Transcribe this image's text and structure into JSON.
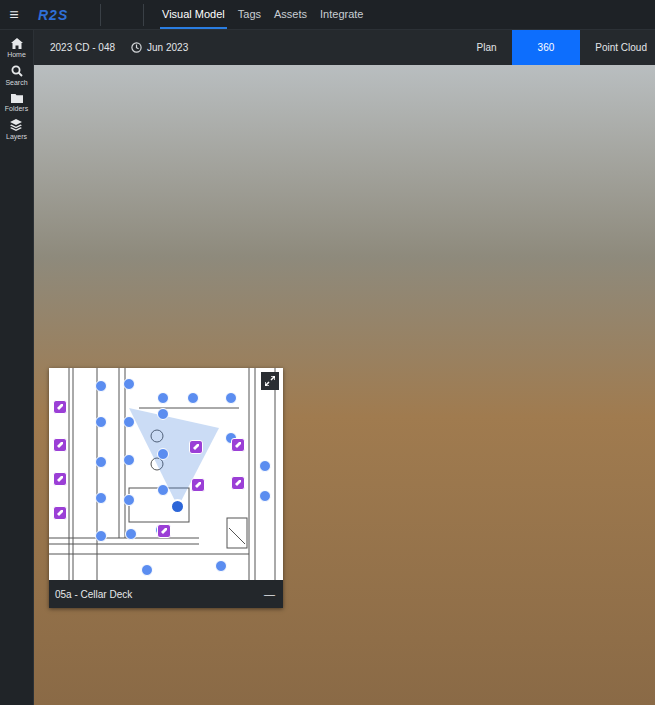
{
  "app": {
    "menu_icon": "≡",
    "logo": "R2S"
  },
  "nav_tabs": [
    {
      "label": "Visual Model",
      "selected": true
    },
    {
      "label": "Tags",
      "selected": false
    },
    {
      "label": "Assets",
      "selected": false
    },
    {
      "label": "Integrate",
      "selected": false
    }
  ],
  "sidebar": {
    "items": [
      {
        "label": "Home"
      },
      {
        "label": "Search"
      },
      {
        "label": "Folders"
      },
      {
        "label": "Layers"
      }
    ]
  },
  "toolbar": {
    "scan_name": "2023 CD - 048",
    "date": "Jun 2023",
    "views": [
      {
        "label": "Plan",
        "selected": false
      },
      {
        "label": "360",
        "selected": true
      },
      {
        "label": "Point Cloud",
        "selected": false
      }
    ]
  },
  "minimap": {
    "title": "05a - Cellar Deck",
    "collapse": "—",
    "pins": [
      {
        "kind": "scan",
        "selected": false
      },
      {
        "kind": "scan",
        "selected": false
      },
      {
        "kind": "scan",
        "selected": false
      },
      {
        "kind": "scan",
        "selected": false
      },
      {
        "kind": "scan",
        "selected": false
      },
      {
        "kind": "scan",
        "selected": false
      },
      {
        "kind": "scan",
        "selected": false
      },
      {
        "kind": "scan",
        "selected": false
      },
      {
        "kind": "scan",
        "selected": false
      },
      {
        "kind": "scan",
        "selected": false
      },
      {
        "kind": "scan",
        "selected": false
      },
      {
        "kind": "scan",
        "selected": false
      },
      {
        "kind": "scan",
        "selected": false
      },
      {
        "kind": "scan",
        "selected": false
      },
      {
        "kind": "scan",
        "selected": false
      },
      {
        "kind": "scan",
        "selected": false
      },
      {
        "kind": "scan",
        "selected": false
      },
      {
        "kind": "scan",
        "selected": false
      },
      {
        "kind": "scan",
        "selected": false
      },
      {
        "kind": "scan",
        "selected": false
      },
      {
        "kind": "scan",
        "selected": false
      },
      {
        "kind": "scan",
        "selected": false
      },
      {
        "kind": "scan",
        "selected": true
      },
      {
        "kind": "tag",
        "selected": false
      },
      {
        "kind": "tag",
        "selected": false
      },
      {
        "kind": "tag",
        "selected": false
      },
      {
        "kind": "tag",
        "selected": false
      },
      {
        "kind": "tag",
        "selected": false
      },
      {
        "kind": "tag",
        "selected": false
      },
      {
        "kind": "tag",
        "selected": false
      },
      {
        "kind": "tag",
        "selected": false
      },
      {
        "kind": "tag",
        "selected": false
      }
    ]
  }
}
